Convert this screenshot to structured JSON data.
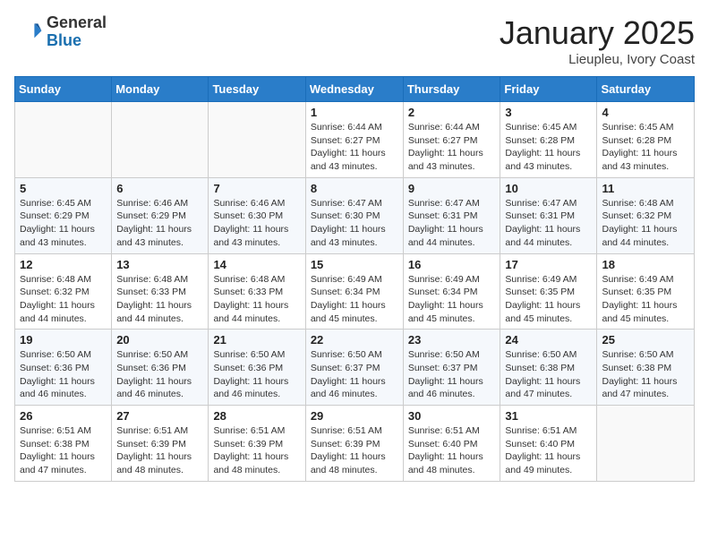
{
  "logo": {
    "general": "General",
    "blue": "Blue"
  },
  "header": {
    "month": "January 2025",
    "location": "Lieupleu, Ivory Coast"
  },
  "weekdays": [
    "Sunday",
    "Monday",
    "Tuesday",
    "Wednesday",
    "Thursday",
    "Friday",
    "Saturday"
  ],
  "weeks": [
    [
      {
        "day": "",
        "sunrise": "",
        "sunset": "",
        "daylight": ""
      },
      {
        "day": "",
        "sunrise": "",
        "sunset": "",
        "daylight": ""
      },
      {
        "day": "",
        "sunrise": "",
        "sunset": "",
        "daylight": ""
      },
      {
        "day": "1",
        "sunrise": "Sunrise: 6:44 AM",
        "sunset": "Sunset: 6:27 PM",
        "daylight": "Daylight: 11 hours and 43 minutes."
      },
      {
        "day": "2",
        "sunrise": "Sunrise: 6:44 AM",
        "sunset": "Sunset: 6:27 PM",
        "daylight": "Daylight: 11 hours and 43 minutes."
      },
      {
        "day": "3",
        "sunrise": "Sunrise: 6:45 AM",
        "sunset": "Sunset: 6:28 PM",
        "daylight": "Daylight: 11 hours and 43 minutes."
      },
      {
        "day": "4",
        "sunrise": "Sunrise: 6:45 AM",
        "sunset": "Sunset: 6:28 PM",
        "daylight": "Daylight: 11 hours and 43 minutes."
      }
    ],
    [
      {
        "day": "5",
        "sunrise": "Sunrise: 6:45 AM",
        "sunset": "Sunset: 6:29 PM",
        "daylight": "Daylight: 11 hours and 43 minutes."
      },
      {
        "day": "6",
        "sunrise": "Sunrise: 6:46 AM",
        "sunset": "Sunset: 6:29 PM",
        "daylight": "Daylight: 11 hours and 43 minutes."
      },
      {
        "day": "7",
        "sunrise": "Sunrise: 6:46 AM",
        "sunset": "Sunset: 6:30 PM",
        "daylight": "Daylight: 11 hours and 43 minutes."
      },
      {
        "day": "8",
        "sunrise": "Sunrise: 6:47 AM",
        "sunset": "Sunset: 6:30 PM",
        "daylight": "Daylight: 11 hours and 43 minutes."
      },
      {
        "day": "9",
        "sunrise": "Sunrise: 6:47 AM",
        "sunset": "Sunset: 6:31 PM",
        "daylight": "Daylight: 11 hours and 44 minutes."
      },
      {
        "day": "10",
        "sunrise": "Sunrise: 6:47 AM",
        "sunset": "Sunset: 6:31 PM",
        "daylight": "Daylight: 11 hours and 44 minutes."
      },
      {
        "day": "11",
        "sunrise": "Sunrise: 6:48 AM",
        "sunset": "Sunset: 6:32 PM",
        "daylight": "Daylight: 11 hours and 44 minutes."
      }
    ],
    [
      {
        "day": "12",
        "sunrise": "Sunrise: 6:48 AM",
        "sunset": "Sunset: 6:32 PM",
        "daylight": "Daylight: 11 hours and 44 minutes."
      },
      {
        "day": "13",
        "sunrise": "Sunrise: 6:48 AM",
        "sunset": "Sunset: 6:33 PM",
        "daylight": "Daylight: 11 hours and 44 minutes."
      },
      {
        "day": "14",
        "sunrise": "Sunrise: 6:48 AM",
        "sunset": "Sunset: 6:33 PM",
        "daylight": "Daylight: 11 hours and 44 minutes."
      },
      {
        "day": "15",
        "sunrise": "Sunrise: 6:49 AM",
        "sunset": "Sunset: 6:34 PM",
        "daylight": "Daylight: 11 hours and 45 minutes."
      },
      {
        "day": "16",
        "sunrise": "Sunrise: 6:49 AM",
        "sunset": "Sunset: 6:34 PM",
        "daylight": "Daylight: 11 hours and 45 minutes."
      },
      {
        "day": "17",
        "sunrise": "Sunrise: 6:49 AM",
        "sunset": "Sunset: 6:35 PM",
        "daylight": "Daylight: 11 hours and 45 minutes."
      },
      {
        "day": "18",
        "sunrise": "Sunrise: 6:49 AM",
        "sunset": "Sunset: 6:35 PM",
        "daylight": "Daylight: 11 hours and 45 minutes."
      }
    ],
    [
      {
        "day": "19",
        "sunrise": "Sunrise: 6:50 AM",
        "sunset": "Sunset: 6:36 PM",
        "daylight": "Daylight: 11 hours and 46 minutes."
      },
      {
        "day": "20",
        "sunrise": "Sunrise: 6:50 AM",
        "sunset": "Sunset: 6:36 PM",
        "daylight": "Daylight: 11 hours and 46 minutes."
      },
      {
        "day": "21",
        "sunrise": "Sunrise: 6:50 AM",
        "sunset": "Sunset: 6:36 PM",
        "daylight": "Daylight: 11 hours and 46 minutes."
      },
      {
        "day": "22",
        "sunrise": "Sunrise: 6:50 AM",
        "sunset": "Sunset: 6:37 PM",
        "daylight": "Daylight: 11 hours and 46 minutes."
      },
      {
        "day": "23",
        "sunrise": "Sunrise: 6:50 AM",
        "sunset": "Sunset: 6:37 PM",
        "daylight": "Daylight: 11 hours and 46 minutes."
      },
      {
        "day": "24",
        "sunrise": "Sunrise: 6:50 AM",
        "sunset": "Sunset: 6:38 PM",
        "daylight": "Daylight: 11 hours and 47 minutes."
      },
      {
        "day": "25",
        "sunrise": "Sunrise: 6:50 AM",
        "sunset": "Sunset: 6:38 PM",
        "daylight": "Daylight: 11 hours and 47 minutes."
      }
    ],
    [
      {
        "day": "26",
        "sunrise": "Sunrise: 6:51 AM",
        "sunset": "Sunset: 6:38 PM",
        "daylight": "Daylight: 11 hours and 47 minutes."
      },
      {
        "day": "27",
        "sunrise": "Sunrise: 6:51 AM",
        "sunset": "Sunset: 6:39 PM",
        "daylight": "Daylight: 11 hours and 48 minutes."
      },
      {
        "day": "28",
        "sunrise": "Sunrise: 6:51 AM",
        "sunset": "Sunset: 6:39 PM",
        "daylight": "Daylight: 11 hours and 48 minutes."
      },
      {
        "day": "29",
        "sunrise": "Sunrise: 6:51 AM",
        "sunset": "Sunset: 6:39 PM",
        "daylight": "Daylight: 11 hours and 48 minutes."
      },
      {
        "day": "30",
        "sunrise": "Sunrise: 6:51 AM",
        "sunset": "Sunset: 6:40 PM",
        "daylight": "Daylight: 11 hours and 48 minutes."
      },
      {
        "day": "31",
        "sunrise": "Sunrise: 6:51 AM",
        "sunset": "Sunset: 6:40 PM",
        "daylight": "Daylight: 11 hours and 49 minutes."
      },
      {
        "day": "",
        "sunrise": "",
        "sunset": "",
        "daylight": ""
      }
    ]
  ]
}
